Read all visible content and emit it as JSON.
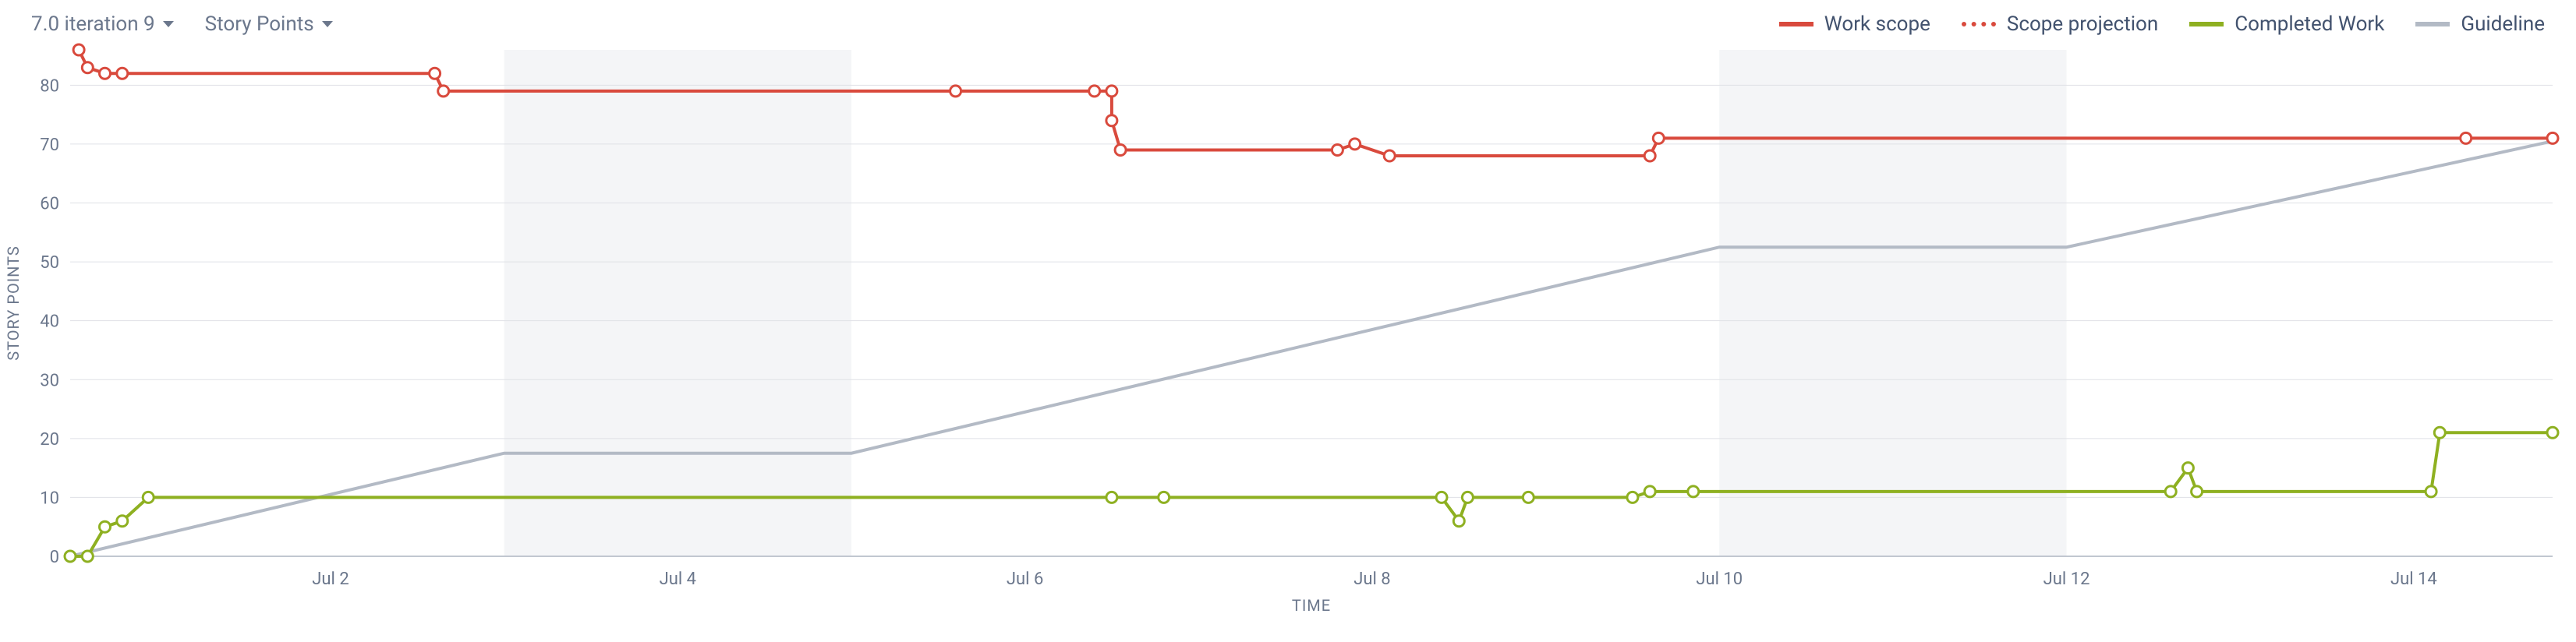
{
  "controls": {
    "sprint_label": "7.0 iteration 9",
    "metric_label": "Story Points"
  },
  "legend": {
    "work_scope": "Work scope",
    "scope_projection": "Scope projection",
    "completed_work": "Completed Work",
    "guideline": "Guideline"
  },
  "axes": {
    "y_title": "STORY POINTS",
    "x_title": "TIME"
  },
  "colors": {
    "work_scope": "#D94A3D",
    "completed_work": "#8EB021",
    "guideline": "#B3BAC5",
    "weekend": "#F4F5F7"
  },
  "chart_data": {
    "type": "line",
    "xlabel": "TIME",
    "ylabel": "STORY POINTS",
    "ylim": [
      0,
      86
    ],
    "xlim": [
      0.5,
      14.8
    ],
    "x_ticks": [
      "Jul 2",
      "Jul 4",
      "Jul 6",
      "Jul 8",
      "Jul 10",
      "Jul 12",
      "Jul 14"
    ],
    "x_tick_positions": [
      2,
      4,
      6,
      8,
      10,
      12,
      14
    ],
    "y_ticks": [
      0,
      10,
      20,
      30,
      40,
      50,
      60,
      70,
      80
    ],
    "weekend_bands": [
      [
        3,
        5
      ],
      [
        10,
        12
      ]
    ],
    "series": [
      {
        "name": "Guideline",
        "color": "guideline",
        "markers": false,
        "points": [
          [
            0.5,
            0
          ],
          [
            3.0,
            17.5
          ],
          [
            5.0,
            17.5
          ],
          [
            10.0,
            52.5
          ],
          [
            12.0,
            52.5
          ],
          [
            14.8,
            70.5
          ]
        ]
      },
      {
        "name": "Work scope",
        "color": "work_scope",
        "markers": true,
        "points": [
          [
            0.55,
            86
          ],
          [
            0.6,
            83
          ],
          [
            0.7,
            82
          ],
          [
            0.8,
            82
          ],
          [
            2.6,
            82
          ],
          [
            2.65,
            79
          ],
          [
            5.6,
            79
          ],
          [
            6.4,
            79
          ],
          [
            6.5,
            79
          ],
          [
            6.5,
            74
          ],
          [
            6.55,
            69
          ],
          [
            7.8,
            69
          ],
          [
            7.9,
            70
          ],
          [
            8.1,
            68
          ],
          [
            9.6,
            68
          ],
          [
            9.65,
            71
          ],
          [
            14.3,
            71
          ],
          [
            14.8,
            71
          ]
        ]
      },
      {
        "name": "Completed Work",
        "color": "completed_work",
        "markers": true,
        "points": [
          [
            0.5,
            0
          ],
          [
            0.6,
            0
          ],
          [
            0.7,
            5
          ],
          [
            0.8,
            6
          ],
          [
            0.95,
            10
          ],
          [
            6.5,
            10
          ],
          [
            6.8,
            10
          ],
          [
            8.4,
            10
          ],
          [
            8.5,
            6
          ],
          [
            8.55,
            10
          ],
          [
            8.9,
            10
          ],
          [
            9.5,
            10
          ],
          [
            9.6,
            11
          ],
          [
            9.85,
            11
          ],
          [
            12.6,
            11
          ],
          [
            12.7,
            15
          ],
          [
            12.75,
            11
          ],
          [
            14.1,
            11
          ],
          [
            14.15,
            21
          ],
          [
            14.8,
            21
          ]
        ]
      }
    ]
  }
}
